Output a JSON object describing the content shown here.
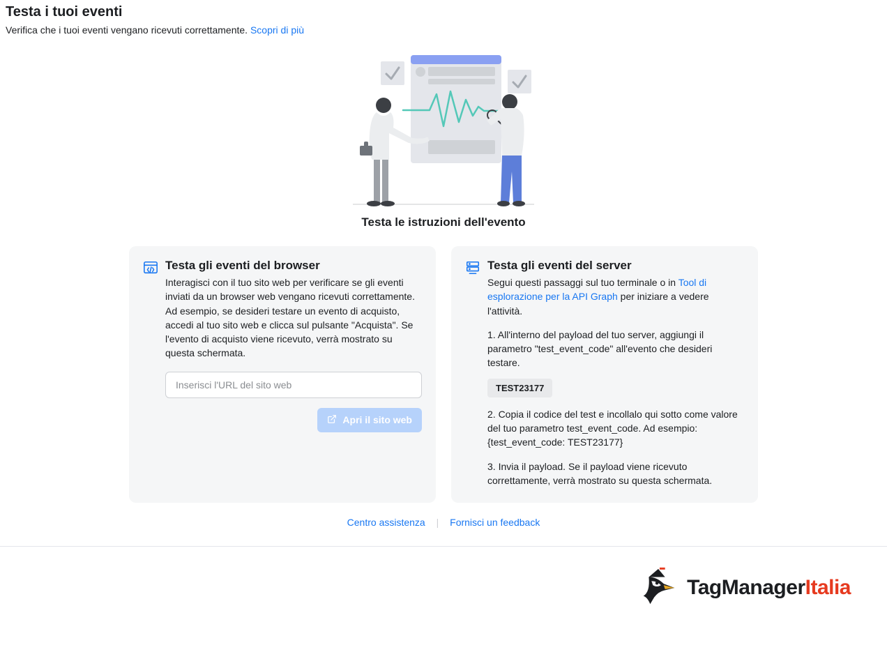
{
  "header": {
    "title": "Testa i tuoi eventi",
    "subtitle": "Verifica che i tuoi eventi vengano ricevuti correttamente. ",
    "learn_more": "Scopri di più"
  },
  "hero_title": "Testa le istruzioni dell'evento",
  "browser_card": {
    "title": "Testa gli eventi del browser",
    "desc": "Interagisci con il tuo sito web per verificare se gli eventi inviati da un browser web vengano ricevuti correttamente. Ad esempio, se desideri testare un evento di acquisto, accedi al tuo sito web e clicca sul pulsante \"Acquista\". Se l'evento di acquisto viene ricevuto, verrà mostrato su questa schermata.",
    "input_placeholder": "Inserisci l'URL del sito web",
    "open_btn": "Apri il sito web"
  },
  "server_card": {
    "title": "Testa gli eventi del server",
    "intro_pre": "Segui questi passaggi sul tuo terminale o in ",
    "intro_link": "Tool di esplorazione per la API Graph",
    "intro_post": " per iniziare a vedere l'attività.",
    "step1": "1. All'interno del payload del tuo server, aggiungi il parametro \"test_event_code\" all'evento che desideri testare.",
    "code": "TEST23177",
    "step2": "2. Copia il codice del test e incollalo qui sotto come valore del tuo parametro test_event_code. Ad esempio: {test_event_code: TEST23177}",
    "step3": "3. Invia il payload. Se il payload viene ricevuto correttamente, verrà mostrato su questa schermata."
  },
  "footer": {
    "help": "Centro assistenza",
    "feedback": "Fornisci un feedback"
  },
  "brand": {
    "pre": "TagManager",
    "accent": "Italia"
  }
}
